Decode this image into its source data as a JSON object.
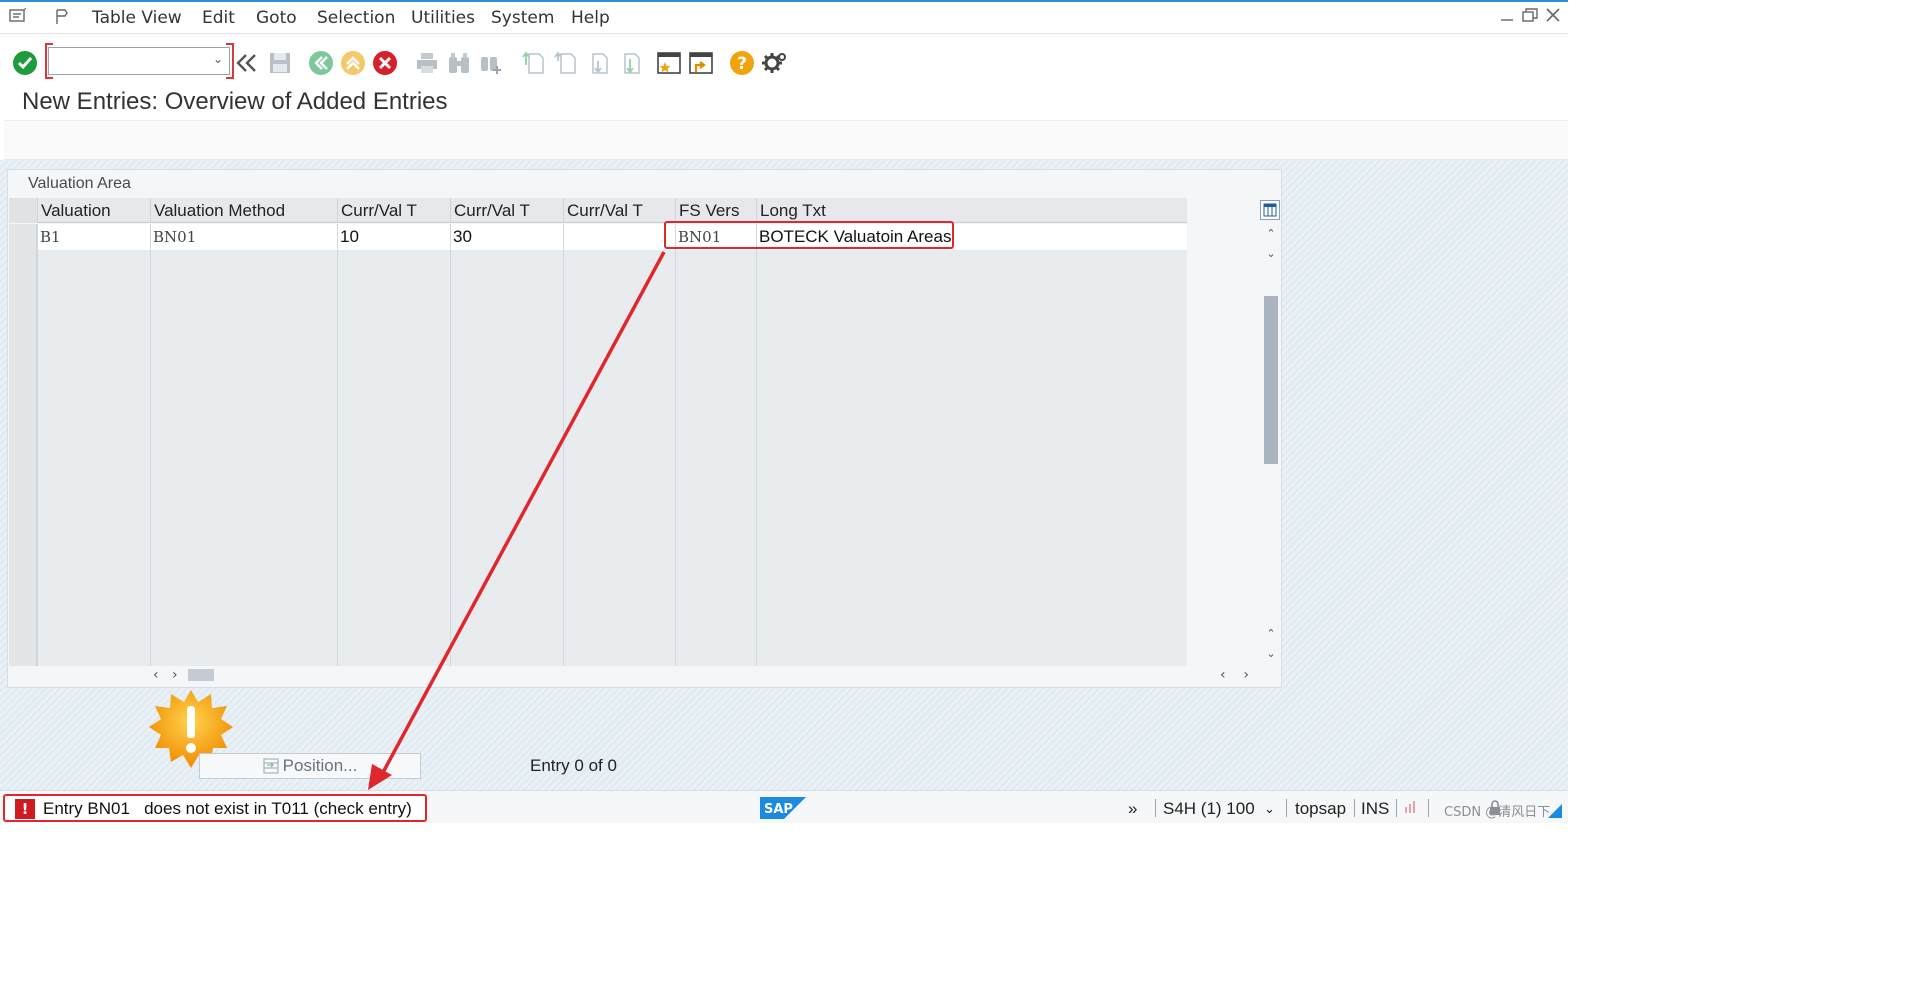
{
  "menubar": {
    "items": [
      "Table View",
      "Edit",
      "Goto",
      "Selection",
      "Utilities",
      "System",
      "Help"
    ]
  },
  "toolbar": {
    "command_value": "",
    "icons": [
      "enter-icon",
      "back-icon",
      "save-icon",
      "back-green-icon",
      "exit-icon",
      "cancel-icon",
      "print-icon",
      "find-icon",
      "find-next-icon",
      "first-page-icon",
      "prev-page-icon",
      "next-page-icon",
      "last-page-icon",
      "create-session-icon",
      "shortcut-icon",
      "help-icon",
      "settings-icon"
    ]
  },
  "title": "New Entries: Overview of Added Entries",
  "table": {
    "caption": "Valuation Area",
    "columns": [
      "Valuation",
      "Valuation Method",
      "Curr/Val T",
      "Curr/Val T",
      "Curr/Val T",
      "FS Vers",
      "Long Txt"
    ],
    "rows": [
      [
        "B1",
        "BN01",
        "10",
        "30",
        "",
        "BN01",
        "BOTECK Valuatoin Areas"
      ]
    ],
    "empty_rows": 16
  },
  "position_button": "Position...",
  "entry_count": "Entry 0 of 0",
  "status": {
    "message": "Entry BN01   does not exist in T011 (check entry)",
    "error_glyph": "!",
    "system": "S4H (1) 100",
    "user": "topsap",
    "mode": "INS",
    "logo": "SAP",
    "watermark": "CSDN @清风日下"
  },
  "colors": {
    "accent": "#2a8fd6",
    "annotation_red": "#e0272d",
    "error_red": "#d01a22",
    "enter_green": "#1e9b3a",
    "help_orange": "#f0a30a"
  }
}
